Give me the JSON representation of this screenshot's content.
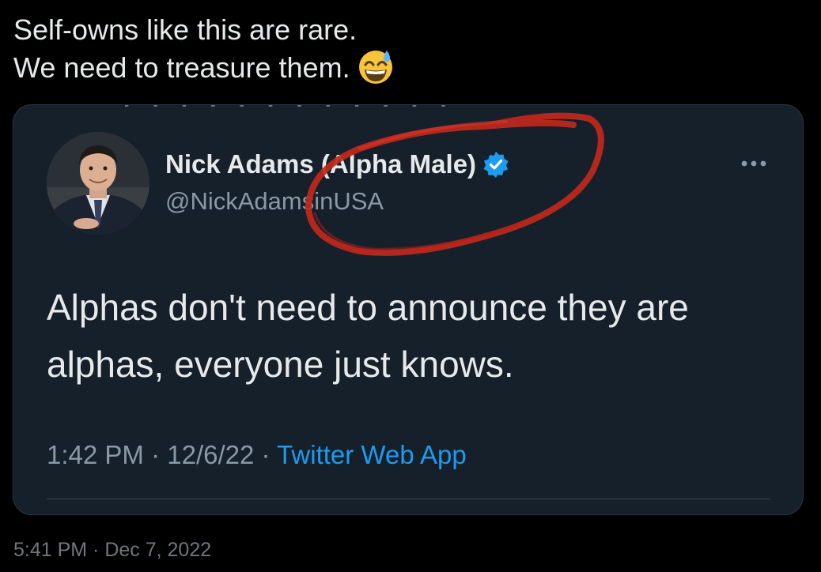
{
  "post": {
    "line1": "Self-owns like this are rare.",
    "line2": "We need to treasure them.",
    "emoji_icon": "grinning-face-with-sweat-emoji",
    "timestamp": "5:41 PM · Dec 7, 2022"
  },
  "quoted_tweet": {
    "display_name": "Nick Adams (Alpha Male)",
    "handle": "@NickAdamsinUSA",
    "verified_icon": "verified-badge-icon",
    "more_icon": "more-options-icon",
    "text": "Alphas don't need to announce they are alphas, everyone just knows.",
    "time": "1:42 PM",
    "date": "12/6/22",
    "separator": " · ",
    "source": "Twitter Web App"
  },
  "colors": {
    "background": "#000000",
    "card_background": "#15202b",
    "text": "#e7e9ea",
    "secondary_text": "#8b98a5",
    "link": "#1d9bf0",
    "verified": "#1d9bf0",
    "annotation_circle": "#c0281c"
  }
}
